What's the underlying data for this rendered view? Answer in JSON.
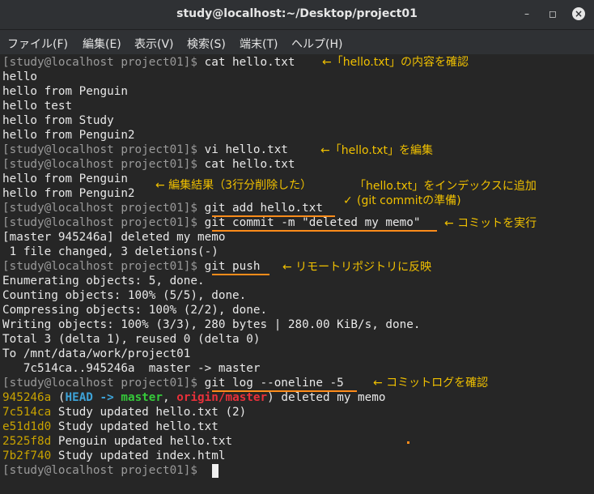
{
  "window": {
    "title": "study@localhost:~/Desktop/project01",
    "minimize_icon": "minimize-icon",
    "maximize_icon": "maximize-icon",
    "close_icon": "close-icon"
  },
  "menu": [
    "ファイル(F)",
    "編集(E)",
    "表示(V)",
    "検索(S)",
    "端末(T)",
    "ヘルプ(H)"
  ],
  "colors": {
    "background": "#262626",
    "prompt": "#9a9a9a",
    "annotation": "#f0c000",
    "underline": "#ff8c1a",
    "hash": "#c8a200",
    "head": "#3ea3d8",
    "branch": "#35c93a",
    "origin": "#e8303a"
  },
  "prompt": "[study@localhost project01]$ ",
  "lines": {
    "l0": "cat hello.txt",
    "l1": "hello",
    "l2": "hello from Penguin",
    "l3": "hello test",
    "l4": "hello from Study",
    "l5": "hello from Penguin2",
    "l6": "vi hello.txt",
    "l7": "cat hello.txt",
    "l8": "hello from Penguin",
    "l9": "hello from Penguin2",
    "l10": "git add hello.txt",
    "l11": "git commit -m \"deleted my memo\"",
    "l12": "[master 945246a] deleted my memo",
    "l13": " 1 file changed, 3 deletions(-)",
    "l14": "git push",
    "l15": "Enumerating objects: 5, done.",
    "l16": "Counting objects: 100% (5/5), done.",
    "l17": "Compressing objects: 100% (2/2), done.",
    "l18": "Writing objects: 100% (3/3), 280 bytes | 280.00 KiB/s, done.",
    "l19": "Total 3 (delta 1), reused 0 (delta 0)",
    "l20": "To /mnt/data/work/project01",
    "l21": "   7c514ca..945246a  master -> master",
    "l22": "git log --oneline -5"
  },
  "log": {
    "c1": {
      "hash": "945246a",
      "open": " (",
      "head": "HEAD -> ",
      "branch": "master",
      "sep": ", ",
      "origin": "origin/master",
      "close": ")",
      "msg": " deleted my memo"
    },
    "c2": {
      "hash": "7c514ca",
      "msg": " Study updated hello.txt (2)"
    },
    "c3": {
      "hash": "e51d1d0",
      "msg": " Study updated hello.txt"
    },
    "c4": {
      "hash": "2525f8d",
      "msg": " Penguin updated hello.txt"
    },
    "c5": {
      "hash": "7b2f740",
      "msg": " Study updated index.html"
    }
  },
  "annotations": {
    "a1": "←「hello.txt」の内容を確認",
    "a2": "←「hello.txt」を編集",
    "a3": "← 編集結果（3行分削除した）",
    "a4": "「hello.txt」をインデックスに追加",
    "a5": "(git commitの準備)",
    "a5_arrow": "✓",
    "a6": "← コミットを実行",
    "a7": "← リモートリポジトリに反映",
    "a8": "← コミットログを確認"
  }
}
